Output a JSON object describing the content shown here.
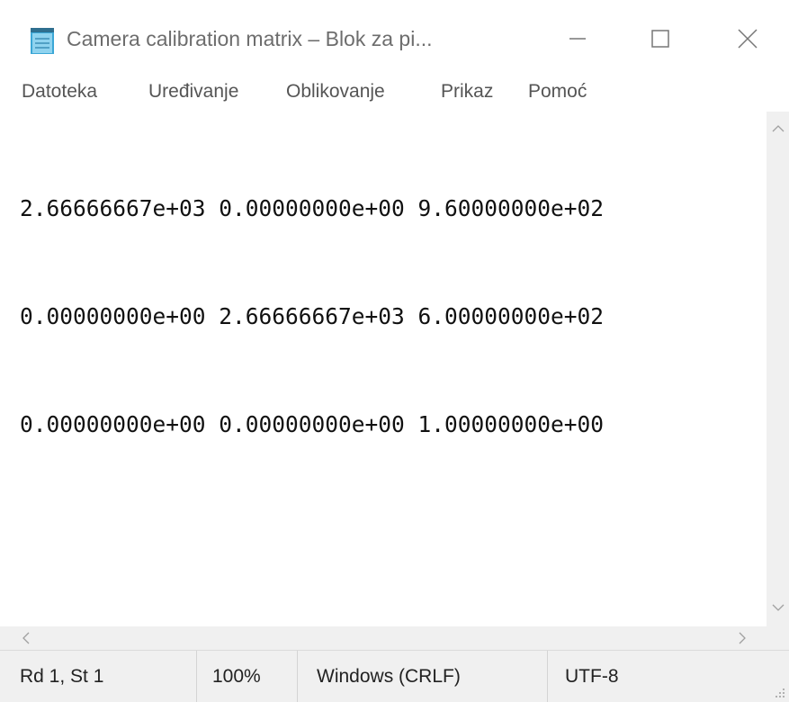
{
  "window": {
    "title": "Camera calibration matrix – Blok za pi...",
    "minimize_icon": "minimize-icon",
    "maximize_icon": "maximize-icon",
    "close_icon": "close-icon",
    "app_icon": "notepad-icon"
  },
  "menu": {
    "items": [
      {
        "label": "Datoteka"
      },
      {
        "label": "Uređivanje"
      },
      {
        "label": "Oblikovanje"
      },
      {
        "label": "Prikaz"
      },
      {
        "label": "Pomoć"
      }
    ]
  },
  "editor": {
    "lines": [
      "2.66666667e+03 0.00000000e+00 9.60000000e+02",
      "0.00000000e+00 2.66666667e+03 6.00000000e+02",
      "0.00000000e+00 0.00000000e+00 1.00000000e+00"
    ]
  },
  "scrollbars": {
    "up_icon": "chevron-up-icon",
    "down_icon": "chevron-down-icon",
    "left_icon": "chevron-left-icon",
    "right_icon": "chevron-right-icon"
  },
  "status": {
    "position": "Rd 1, St 1",
    "zoom": "100%",
    "line_ending": "Windows (CRLF)",
    "encoding": "UTF-8"
  },
  "colors": {
    "window_bg": "#ffffff",
    "chrome_bg": "#f0f0f0",
    "text": "#111111",
    "title_text": "#6d6d6d",
    "menu_text": "#555555"
  }
}
